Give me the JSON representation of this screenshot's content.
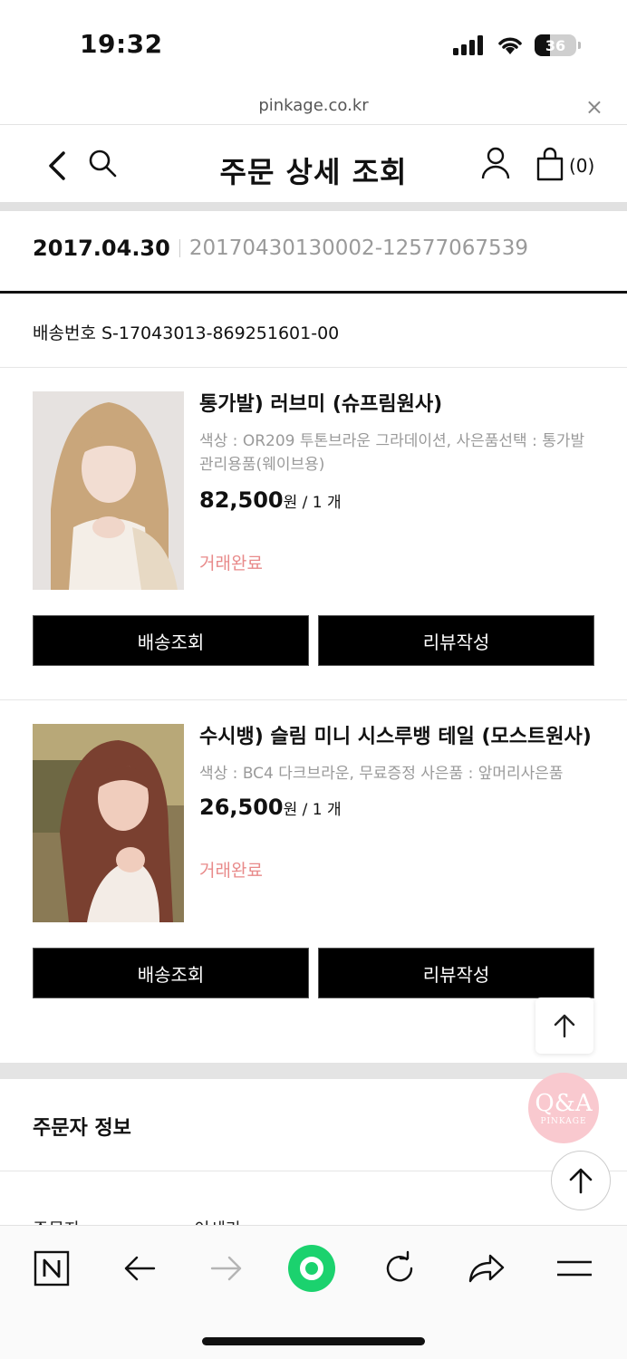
{
  "status_bar": {
    "time": "19:32",
    "battery": "36"
  },
  "browser": {
    "url": "pinkage.co.kr",
    "close_label": "×"
  },
  "header": {
    "title": "주문 상세 조회",
    "cart_count": "(0)"
  },
  "order": {
    "date": "2017.04.30",
    "number": "20170430130002-12577067539"
  },
  "shipping": {
    "label": "배송번호 S-17043013-869251601-00"
  },
  "products": [
    {
      "name": "통가발) 러브미 (슈프림원사)",
      "option": "색상 : OR209 투톤브라운 그라데이션, 사은품선택 : 통가발 관리용품(웨이브용)",
      "price": "82,500",
      "currency": "원",
      "qty": " / 1 개",
      "status": "거래완료",
      "btn_track": "배송조회",
      "btn_review": "리뷰작성"
    },
    {
      "name": "수시뱅) 슬림 미니 시스루뱅 테일 (모스트원사)",
      "option": "색상 : BC4 다크브라운, 무료증정 사은품 : 앞머리사은품",
      "price": "26,500",
      "currency": "원",
      "qty": " / 1 개",
      "status": "거래완료",
      "btn_track": "배송조회",
      "btn_review": "리뷰작성"
    }
  ],
  "orderer": {
    "title": "주문자 정보",
    "partial_left": "주문자",
    "partial_right": "이세라"
  },
  "qa_badge": {
    "title": "Q&A",
    "brand": "PINKAGE"
  },
  "colors": {
    "status_pink": "#e88a8a",
    "accent_green": "#1bd26e"
  }
}
